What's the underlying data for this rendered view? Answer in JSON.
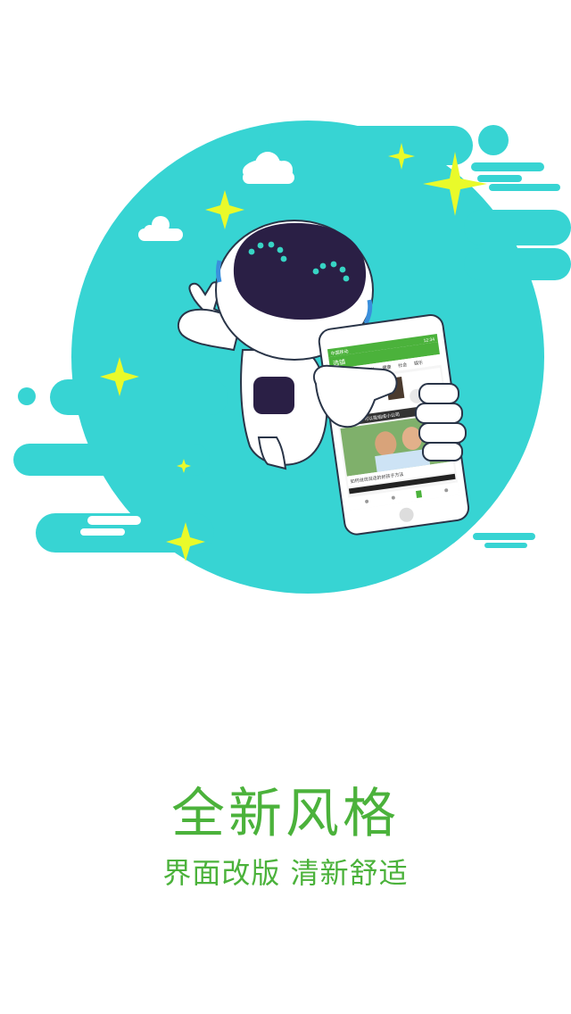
{
  "splash": {
    "headline": "全新风格",
    "subline": "界面改版 清新舒适"
  },
  "phone": {
    "status_left": "中国移动",
    "status_right": "12:34",
    "header_title": "选镇",
    "nav_tabs": [
      "推荐",
      "育儿",
      "健康",
      "社会",
      "娱乐"
    ],
    "feature_caption": "新年礼子，可以能组成小公司",
    "article_title": "如何说说说话的好孩子方法"
  },
  "colors": {
    "theme_teal": "#37d4d3",
    "brand_green": "#4bb23b",
    "star_yellow": "#e9fa2a",
    "robot_visor": "#2a1f45",
    "eye_cyan": "#37d4c4"
  }
}
